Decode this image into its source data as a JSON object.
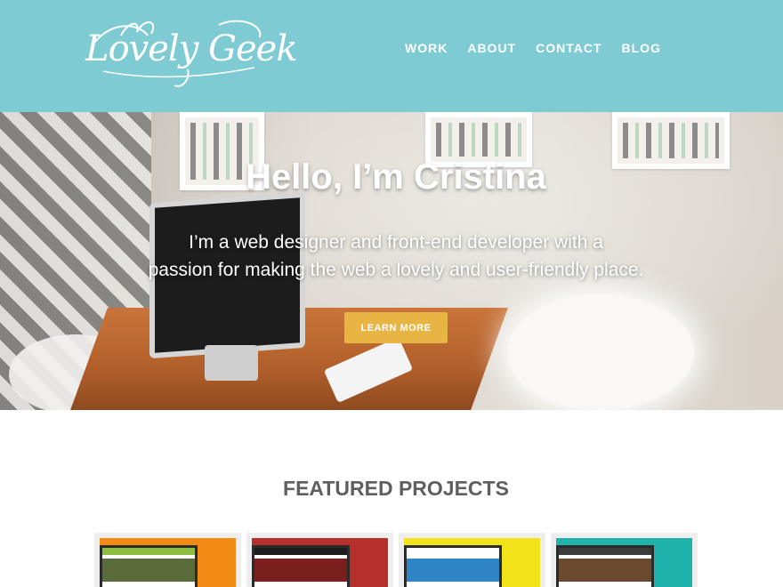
{
  "header": {
    "logo_text": "Lovely Geek",
    "nav": [
      "WORK",
      "ABOUT",
      "CONTACT",
      "BLOG"
    ]
  },
  "hero": {
    "title": "Hello, I’m Cristina",
    "subtitle_line1": "I’m a web designer and front-end developer with a",
    "subtitle_line2": "passion for making the web a lovely and user-friendly place.",
    "cta_label": "LEARN MORE"
  },
  "featured": {
    "title": "FEATURED PROJECTS",
    "projects": [
      {
        "icon": "project-thumbnail",
        "color": "#f28a13",
        "screen_color": "#8cbf3f"
      },
      {
        "icon": "project-thumbnail",
        "color": "#b5302b",
        "screen_color": "#7a1e1e"
      },
      {
        "icon": "project-thumbnail",
        "color": "#f2e21a",
        "screen_color": "#2f84c6"
      },
      {
        "icon": "project-thumbnail",
        "color": "#1fb3ab",
        "screen_color": "#6b4a2f"
      }
    ]
  },
  "colors": {
    "header_bg": "#7ecbd3",
    "cta_bg": "#e8b444",
    "heading_text": "#5f5f5f"
  }
}
